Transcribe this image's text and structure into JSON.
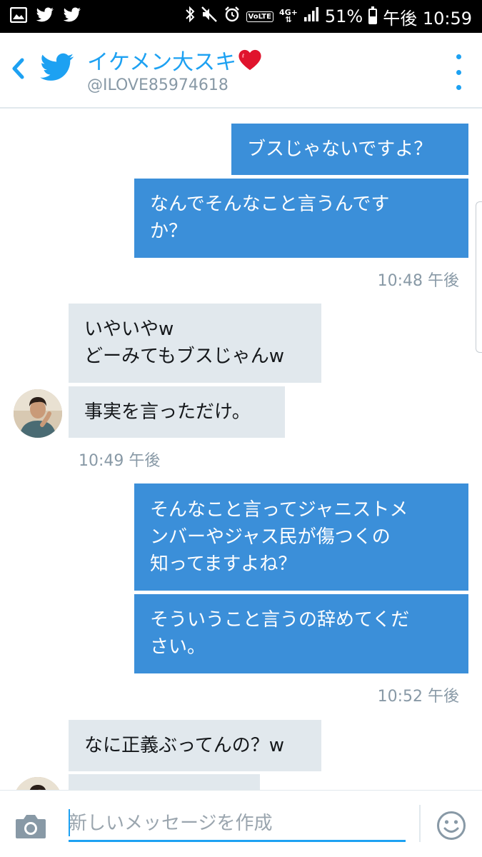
{
  "status_bar": {
    "battery": "51%",
    "time": "午後 10:59",
    "network": "4G+",
    "volte": "VoLTE",
    "left_icons": [
      "image-icon",
      "twitter-notification-icon",
      "twitter-notification-icon"
    ],
    "right_icons": [
      "bluetooth-icon",
      "mute-icon",
      "alarm-icon",
      "volte-icon",
      "lte-icon",
      "signal-icon",
      "battery-icon"
    ],
    "battery_level": 0.51
  },
  "header": {
    "name": "イケメン大スキ",
    "handle": "@ILOVE85974618",
    "accent_color": "#1da1f2"
  },
  "messages": [
    {
      "direction": "out",
      "lines": [
        "ブスじゃないですよ？"
      ]
    },
    {
      "direction": "out",
      "lines": [
        "なんでそんなこと言うんです",
        "か？"
      ]
    },
    {
      "direction": "out",
      "timestamp": "10:48 午後"
    },
    {
      "direction": "in",
      "lines": [
        "いやいやw",
        "どーみてもブスじゃんw"
      ]
    },
    {
      "direction": "in",
      "lines": [
        "事実を言っただけ。"
      ]
    },
    {
      "direction": "in",
      "timestamp": "10:49 午後"
    },
    {
      "direction": "out",
      "lines": [
        "そんなこと言ってジャニストメ",
        "ンバーやジャス民が傷つくの",
        "知ってますよね？"
      ]
    },
    {
      "direction": "out",
      "lines": [
        "そういうこと言うの辞めてくだ",
        "さい。"
      ]
    },
    {
      "direction": "out",
      "timestamp": "10:52 午後"
    },
    {
      "direction": "in",
      "lines": [
        "なに正義ぶってんの？w"
      ]
    }
  ],
  "composer": {
    "placeholder": "新しいメッセージを作成",
    "value": ""
  },
  "colors": {
    "outgoing_bubble": "#3b8fd9",
    "incoming_bubble": "#e1e8ed",
    "timestamp": "#8899a6"
  }
}
